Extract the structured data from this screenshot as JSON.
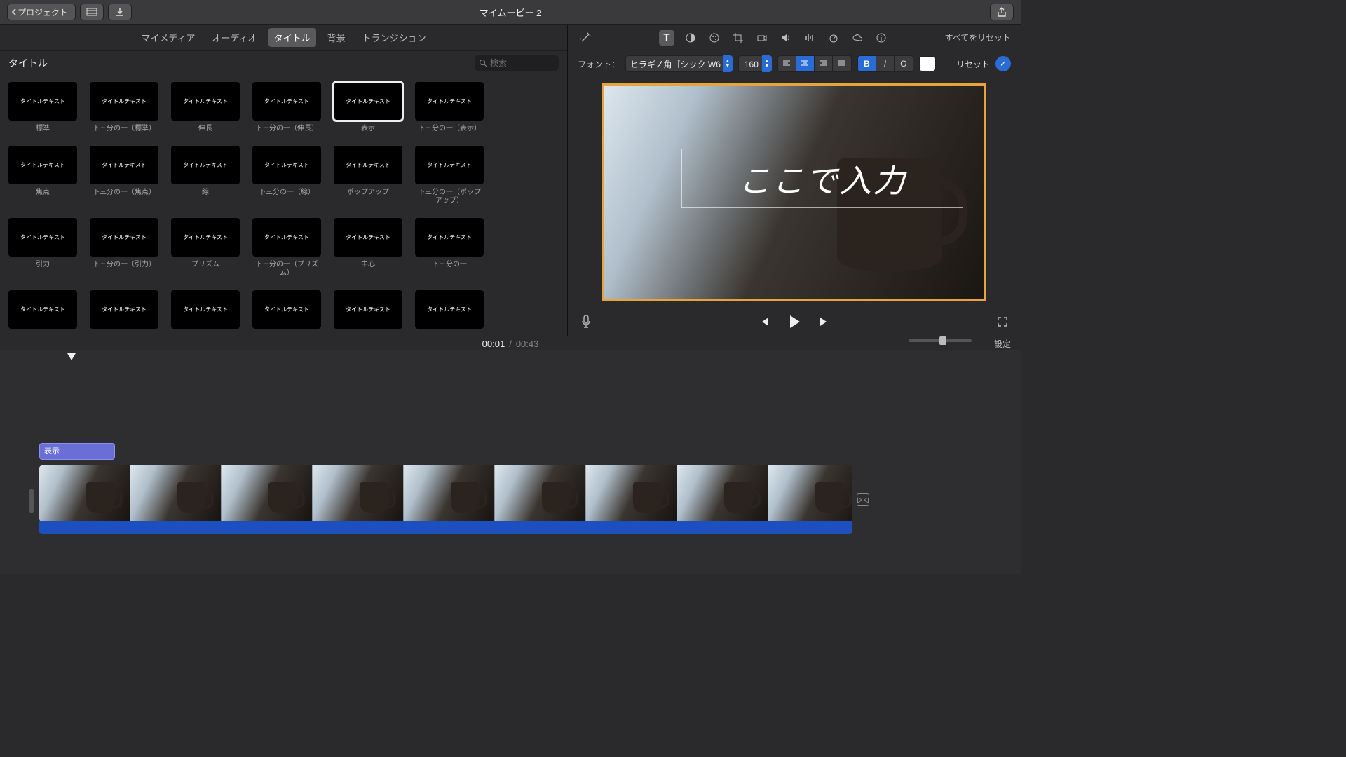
{
  "topbar": {
    "back_label": "プロジェクト",
    "title": "マイムービー 2"
  },
  "browser": {
    "tabs": [
      "マイメディア",
      "オーディオ",
      "タイトル",
      "背景",
      "トランジション"
    ],
    "active_tab": 2,
    "section_title": "タイトル",
    "search_placeholder": "検索",
    "tiles": [
      {
        "label": "標準"
      },
      {
        "label": "下三分の一（標準）"
      },
      {
        "label": "伸長"
      },
      {
        "label": "下三分の一（伸長）"
      },
      {
        "label": "表示",
        "selected": true
      },
      {
        "label": "下三分の一（表示）"
      },
      {
        "label": "焦点"
      },
      {
        "label": "下三分の一（焦点）"
      },
      {
        "label": "線"
      },
      {
        "label": "下三分の一（線）"
      },
      {
        "label": "ポップアップ"
      },
      {
        "label": "下三分の一（ポップアップ）"
      },
      {
        "label": "引力"
      },
      {
        "label": "下三分の一（引力）"
      },
      {
        "label": "プリズム"
      },
      {
        "label": "下三分の一（プリズム）"
      },
      {
        "label": "中心"
      },
      {
        "label": "下三分の一"
      },
      {
        "label": ""
      },
      {
        "label": ""
      },
      {
        "label": ""
      },
      {
        "label": ""
      },
      {
        "label": ""
      },
      {
        "label": ""
      }
    ],
    "thumb_placeholder": "タイトルテキスト"
  },
  "viewer": {
    "reset_all": "すべてをリセット",
    "font_label": "フォント：",
    "font_name": "ヒラギノ角ゴシック W6",
    "font_size": "160",
    "bold": "B",
    "italic": "I",
    "outline": "O",
    "reset": "リセット",
    "title_text": "ここで入力"
  },
  "time": {
    "current": "00:01",
    "separator": "/",
    "duration": "00:43",
    "settings": "設定"
  },
  "timeline": {
    "title_clip_label": "表示",
    "frame_count": 9
  }
}
